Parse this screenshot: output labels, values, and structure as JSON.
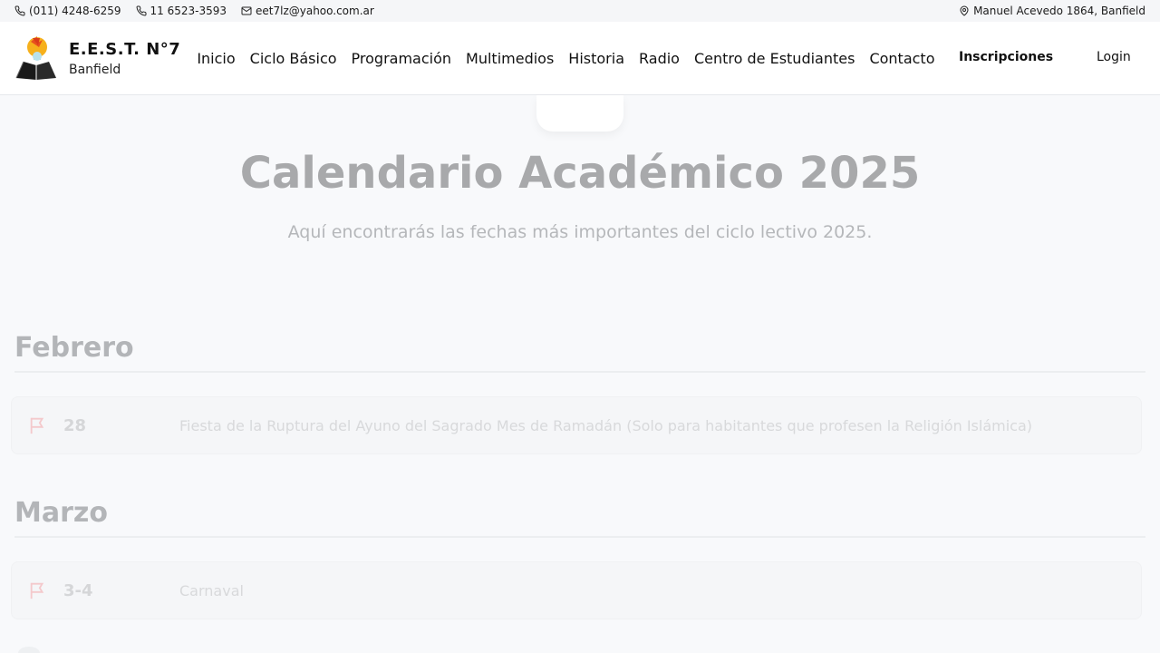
{
  "topbar": {
    "phone1": "(011) 4248-6259",
    "phone2": "11 6523-3593",
    "email": "eet7lz@yahoo.com.ar",
    "address": "Manuel Acevedo 1864, Banfield"
  },
  "brand": {
    "name": "E.E.S.T. N°7",
    "subtitle": "Banfield"
  },
  "nav": {
    "items": [
      "Inicio",
      "Ciclo Básico",
      "Programación",
      "Multimedios",
      "Historia",
      "Radio",
      "Centro de Estudiantes",
      "Contacto"
    ],
    "inscripciones": "Inscripciones",
    "login": "Login"
  },
  "hero": {
    "title": "Calendario Académico 2025",
    "subtitle": "Aquí encontrarás las fechas más importantes del ciclo lectivo 2025."
  },
  "months": [
    {
      "name": "Febrero",
      "events": [
        {
          "date": "28",
          "description": "Fiesta de la Ruptura del Ayuno del Sagrado Mes de Ramadán (Solo para habitantes que profesen la Religión Islámica)"
        }
      ]
    },
    {
      "name": "Marzo",
      "events": [
        {
          "date": "3-4",
          "description": "Carnaval"
        }
      ]
    }
  ],
  "colors": {
    "accent_flag": "#f4c9cc",
    "title_gray": "#a8a9ab"
  }
}
